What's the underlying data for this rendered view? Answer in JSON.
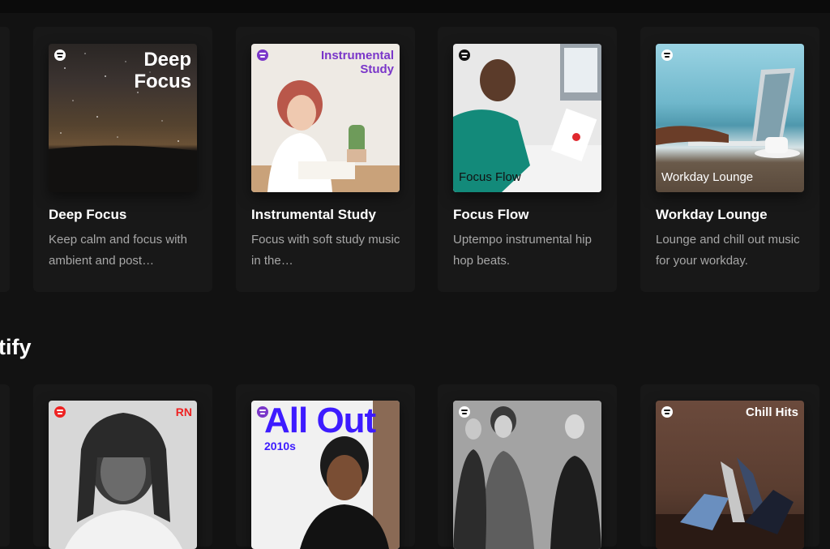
{
  "section_top": {
    "cards": [
      {
        "title": "Deep Focus",
        "description": "Keep calm and focus with ambient and post…",
        "cover_text": "Deep Focus"
      },
      {
        "title": "Instrumental Study",
        "description": "Focus with soft study music in the…",
        "cover_text": "Instrumental Study"
      },
      {
        "title": "Focus Flow",
        "description": "Uptempo instrumental hip hop beats.",
        "cover_text": "Focus Flow"
      },
      {
        "title": "Workday Lounge",
        "description": "Lounge and chill out music for your workday.",
        "cover_text": "Workday Lounge"
      }
    ]
  },
  "section_bottom": {
    "heading": "tify",
    "cards": [
      {
        "cover_text": "RN"
      },
      {
        "cover_text": "All Out",
        "cover_subtext": "2010s"
      },
      {
        "cover_text": ""
      },
      {
        "cover_text": "Chill Hits"
      }
    ]
  },
  "colors": {
    "background": "#121212",
    "card": "#181818",
    "muted_text": "#a7a7a7",
    "spotify_green": "#1db954"
  }
}
